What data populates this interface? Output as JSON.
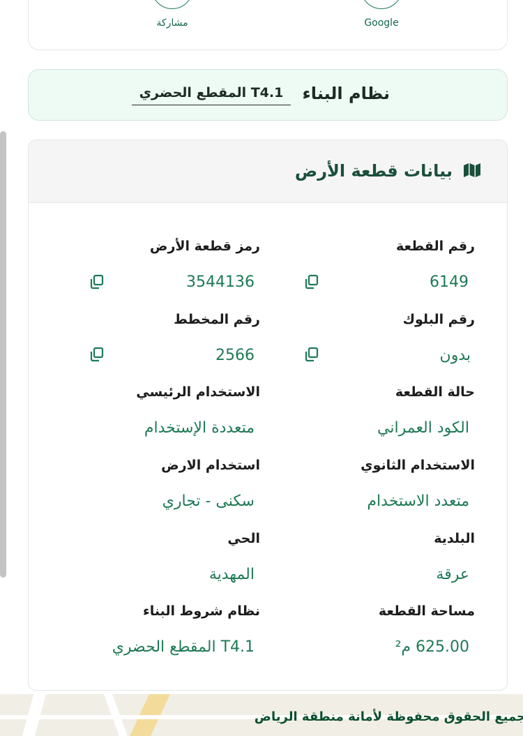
{
  "share": {
    "google_label": "Google",
    "share_label": "مشاركة"
  },
  "building_system": {
    "title": "نظام البناء",
    "value": "T4.1 المقطع الحضري"
  },
  "land": {
    "title": "بيانات قطعة الأرض",
    "fields": {
      "plot_number_label": "رقم القطعة",
      "plot_number_value": "6149",
      "land_code_label": "رمز قطعة الأرض",
      "land_code_value": "3544136",
      "block_number_label": "رقم البلوك",
      "block_number_value": "بدون",
      "plan_number_label": "رقم المخطط",
      "plan_number_value": "2566",
      "plot_status_label": "حالة القطعة",
      "plot_status_value": "الكود العمراني",
      "main_use_label": "الاستخدام الرئيسي",
      "main_use_value": "متعددة الإستخدام",
      "secondary_use_label": "الاستخدام الثانوي",
      "secondary_use_value": "متعدد الاستخدام",
      "land_use_label": "استخدام الارض",
      "land_use_value": "سكنى - تجاري",
      "municipality_label": "البلدية",
      "municipality_value": "عرقة",
      "district_label": "الحي",
      "district_value": "المهدية",
      "area_label": "مساحة القطعة",
      "area_value": "625.00 م²",
      "building_conditions_label": "نظام شروط البناء",
      "building_conditions_value": "T4.1 المقطع الحضري"
    }
  },
  "footer": {
    "copyright": "جميع الحقوق محفوظة لأمانة منطقة الرياض"
  }
}
